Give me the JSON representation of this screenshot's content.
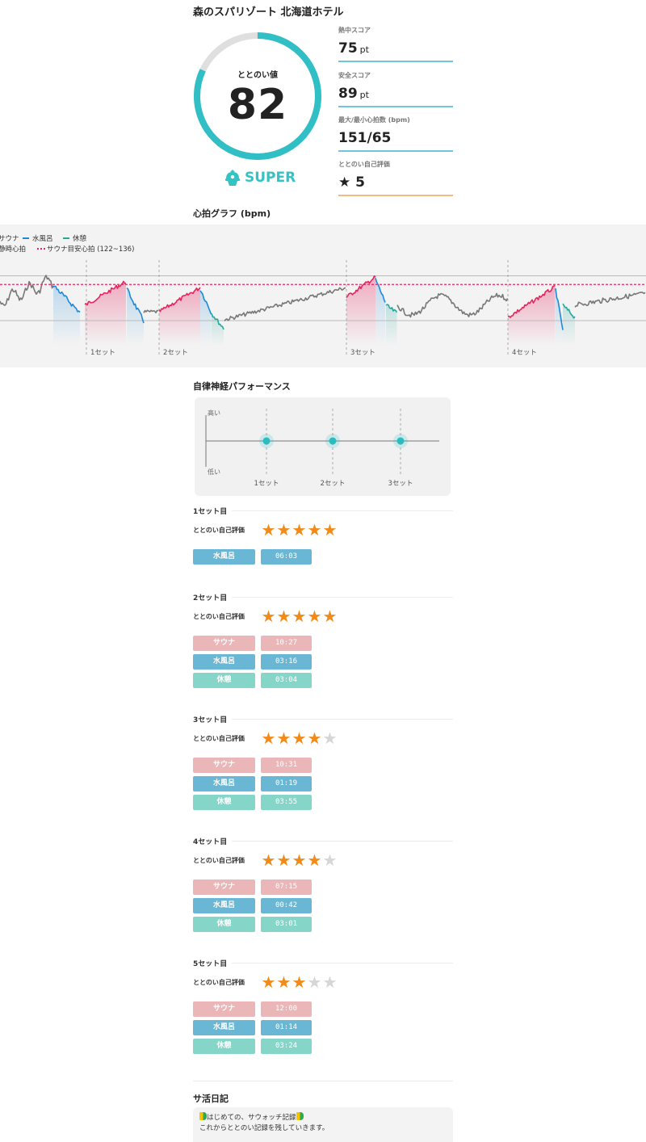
{
  "facility_name": "森のスパリゾート 北海道ホテル",
  "totonoi": {
    "label": "ととのい値",
    "value": "82",
    "progress": 0.82
  },
  "rank": {
    "label": "SUPER",
    "icon": "badge-icon"
  },
  "scores": [
    {
      "label": "熱中スコア",
      "value": "75",
      "unit": "pt",
      "color": "#6cc7d8"
    },
    {
      "label": "安全スコア",
      "value": "89",
      "unit": "pt",
      "color": "#6cc7d8"
    },
    {
      "label": "最大/最小心拍数 (bpm)",
      "value": "151/65",
      "unit": "",
      "color": "#6cc7d8"
    },
    {
      "label": "ととのい自己評価",
      "value": "★ 5",
      "unit": "",
      "color": "#f5b983"
    }
  ],
  "hr_section_title": "心拍グラフ (bpm)",
  "autonomic_title": "自律神経パフォーマンス",
  "chart_data": [
    {
      "type": "line",
      "legend": [
        "サウナ",
        "水風呂",
        "休憩",
        "静時心拍",
        "サウナ目安心拍 (122~136)"
      ],
      "x_labels": [
        "1セット",
        "2セット",
        "3セット",
        "4セット"
      ],
      "target_band": [
        122,
        136
      ],
      "max": 151,
      "min": 65,
      "colors": {
        "sauna": "#e8245f",
        "water": "#1d89d8",
        "rest": "#23a89e",
        "base": "#777777",
        "target": "#e8245f"
      }
    },
    {
      "type": "scatter",
      "y_labels": [
        "高い",
        "低い"
      ],
      "categories": [
        "1セット",
        "2セット",
        "3セット"
      ],
      "values": [
        0,
        0,
        0
      ],
      "color": "#29bcc0"
    }
  ],
  "rating_label": "ととのい自己評価",
  "sets": [
    {
      "title": "1セット目",
      "rating": 5,
      "items": [
        {
          "name": "水風呂",
          "time": "06:03",
          "kind": "water"
        }
      ]
    },
    {
      "title": "2セット目",
      "rating": 5,
      "items": [
        {
          "name": "サウナ",
          "time": "10:27",
          "kind": "sauna"
        },
        {
          "name": "水風呂",
          "time": "03:16",
          "kind": "water"
        },
        {
          "name": "休憩",
          "time": "03:04",
          "kind": "rest"
        }
      ]
    },
    {
      "title": "3セット目",
      "rating": 4,
      "items": [
        {
          "name": "サウナ",
          "time": "10:31",
          "kind": "sauna"
        },
        {
          "name": "水風呂",
          "time": "01:19",
          "kind": "water"
        },
        {
          "name": "休憩",
          "time": "03:55",
          "kind": "rest"
        }
      ]
    },
    {
      "title": "4セット目",
      "rating": 4,
      "items": [
        {
          "name": "サウナ",
          "time": "07:15",
          "kind": "sauna"
        },
        {
          "name": "水風呂",
          "time": "00:42",
          "kind": "water"
        },
        {
          "name": "休憩",
          "time": "03:01",
          "kind": "rest"
        }
      ]
    },
    {
      "title": "5セット目",
      "rating": 3,
      "items": [
        {
          "name": "サウナ",
          "time": "12:00",
          "kind": "sauna"
        },
        {
          "name": "水風呂",
          "time": "01:14",
          "kind": "water"
        },
        {
          "name": "休憩",
          "time": "03:24",
          "kind": "rest"
        }
      ]
    }
  ],
  "diary": {
    "title": "サ活日記",
    "line1": "はじめての、サウォッチ記録",
    "line2": "これからととのい記録を残していきます。"
  }
}
